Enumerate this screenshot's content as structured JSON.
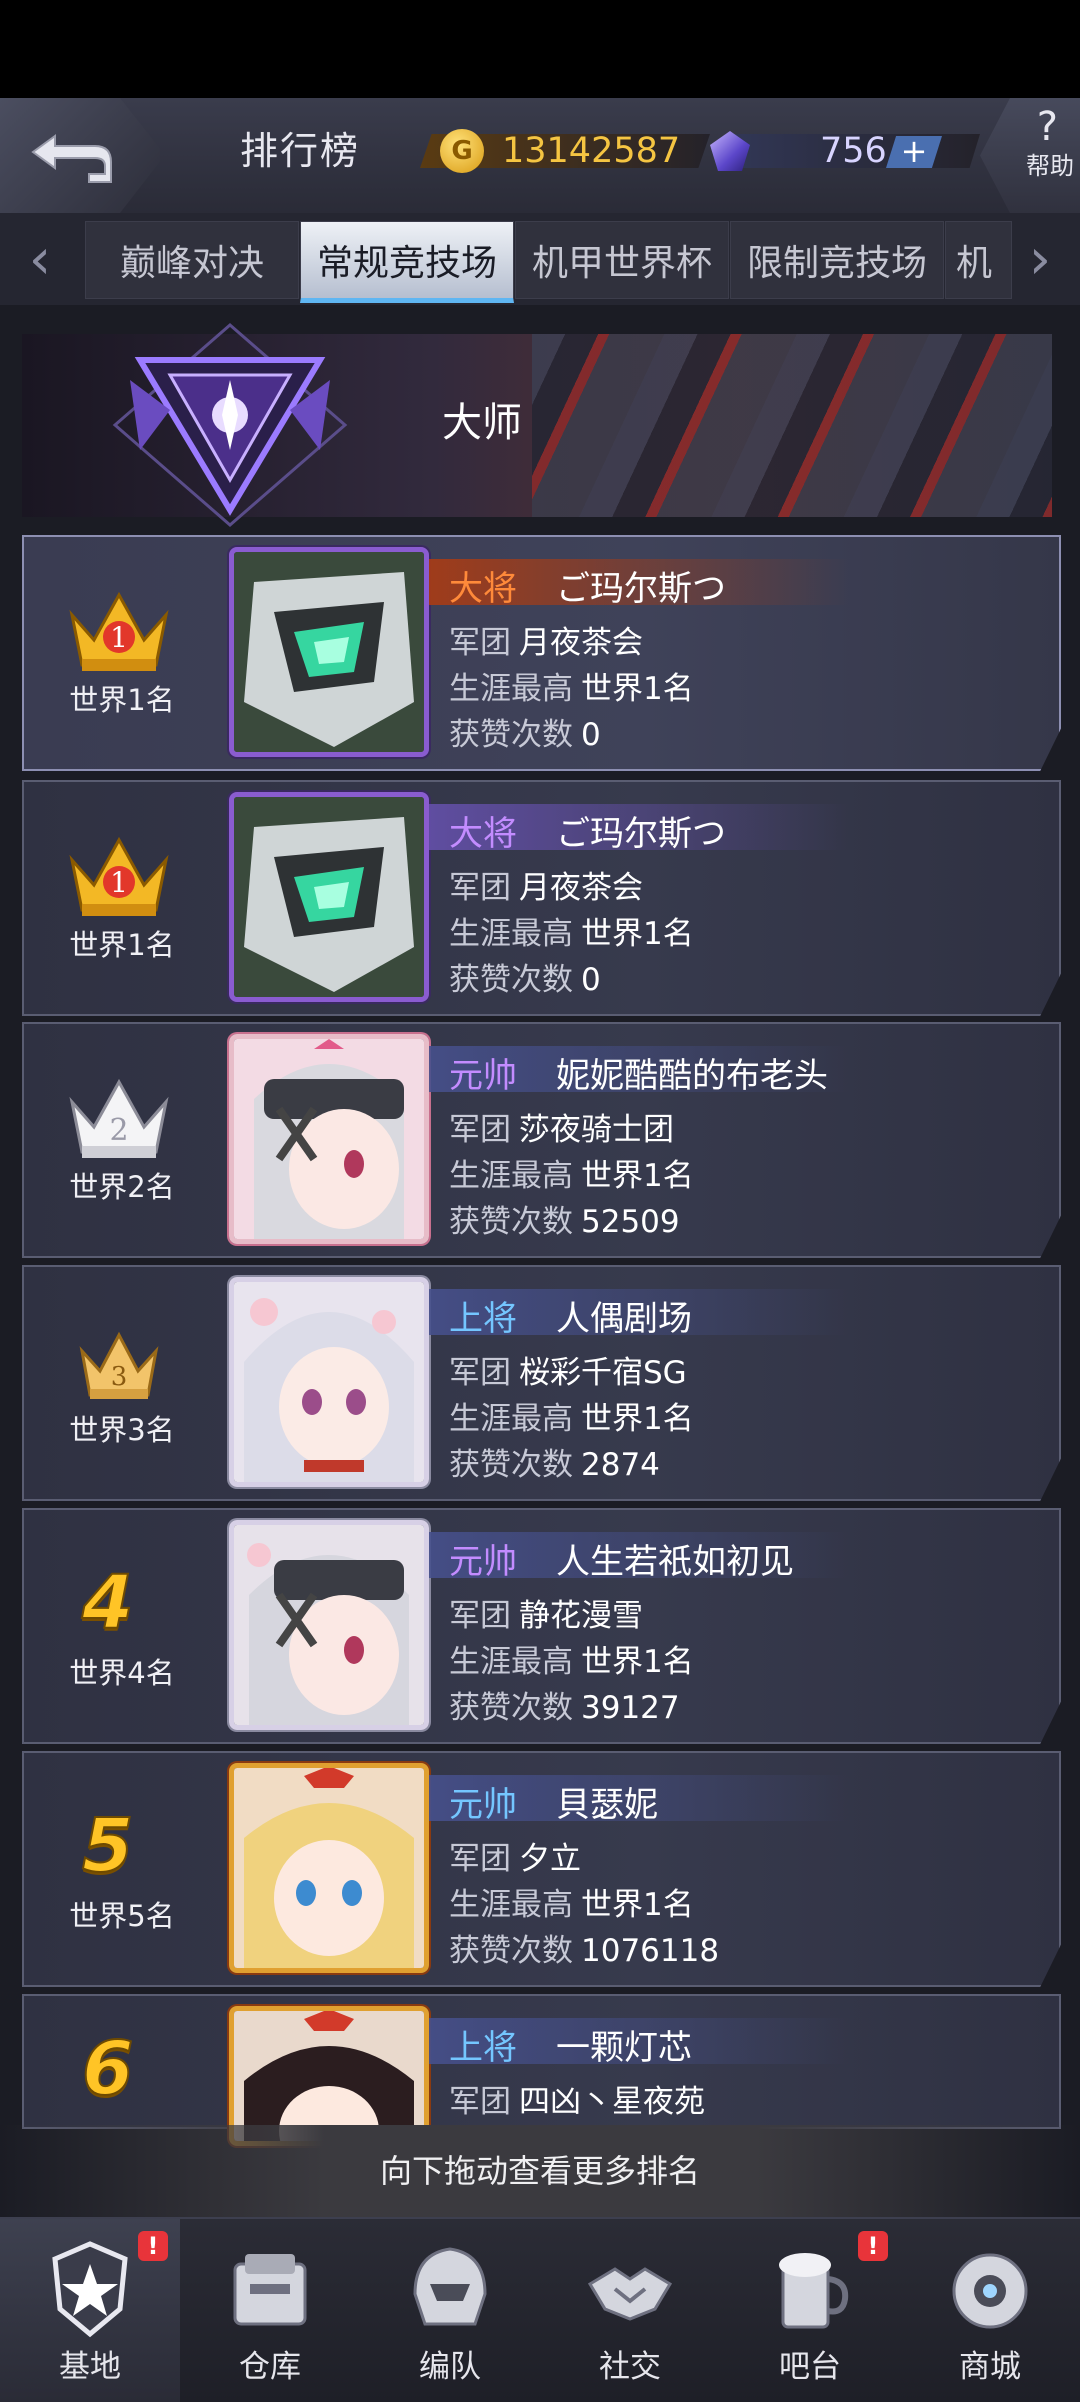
{
  "header": {
    "title": "排行榜",
    "coins": "13142587",
    "gems": "756",
    "plus": "+",
    "help_symbol": "?",
    "help_label": "帮助"
  },
  "tabs": [
    {
      "label": "巅峰对决"
    },
    {
      "label": "常规竞技场"
    },
    {
      "label": "机甲世界杯"
    },
    {
      "label": "限制竞技场"
    },
    {
      "label": "机"
    }
  ],
  "tier": {
    "name": "大师"
  },
  "labels": {
    "legion": "军团",
    "career_best": "生涯最高",
    "likes": "获赞次数"
  },
  "entries": [
    {
      "rank_num": "1",
      "world_rank": "世界1名",
      "title": "大将",
      "name": "ご玛尔斯つ",
      "legion": "月夜茶会",
      "career_best": "世界1名",
      "likes": "0"
    },
    {
      "rank_num": "1",
      "world_rank": "世界1名",
      "title": "大将",
      "name": "ご玛尔斯つ",
      "legion": "月夜茶会",
      "career_best": "世界1名",
      "likes": "0"
    },
    {
      "rank_num": "2",
      "world_rank": "世界2名",
      "title": "元帅",
      "name": "妮妮酷酷的布老头",
      "legion": "莎夜骑士团",
      "career_best": "世界1名",
      "likes": "52509"
    },
    {
      "rank_num": "3",
      "world_rank": "世界3名",
      "title": "上将",
      "name": "人偶剧场",
      "legion": "桜彩千宿SG",
      "career_best": "世界1名",
      "likes": "2874"
    },
    {
      "rank_num": "4",
      "world_rank": "世界4名",
      "title": "元帅",
      "name": "人生若祇如初见",
      "legion": "静花漫雪",
      "career_best": "世界1名",
      "likes": "39127"
    },
    {
      "rank_num": "5",
      "world_rank": "世界5名",
      "title": "元帅",
      "name": "貝瑟妮",
      "legion": "夕立",
      "career_best": "世界1名",
      "likes": "1076118"
    },
    {
      "rank_num": "6",
      "title": "上将",
      "name": "一颗灯芯",
      "legion": "四凶丶星夜苑"
    }
  ],
  "hint": "向下拖动查看更多排名",
  "nav": [
    {
      "label": "基地",
      "badge": "!"
    },
    {
      "label": "仓库"
    },
    {
      "label": "编队"
    },
    {
      "label": "社交"
    },
    {
      "label": "吧台",
      "badge": "!"
    },
    {
      "label": "商城"
    }
  ],
  "colors": {
    "gold": "#ffc426",
    "accent_blue": "#5fb6f2",
    "title_orange": "#ff8a3a",
    "title_purple": "#c38cff",
    "title_cyan": "#74c6ff",
    "badge_red": "#e8343a"
  }
}
